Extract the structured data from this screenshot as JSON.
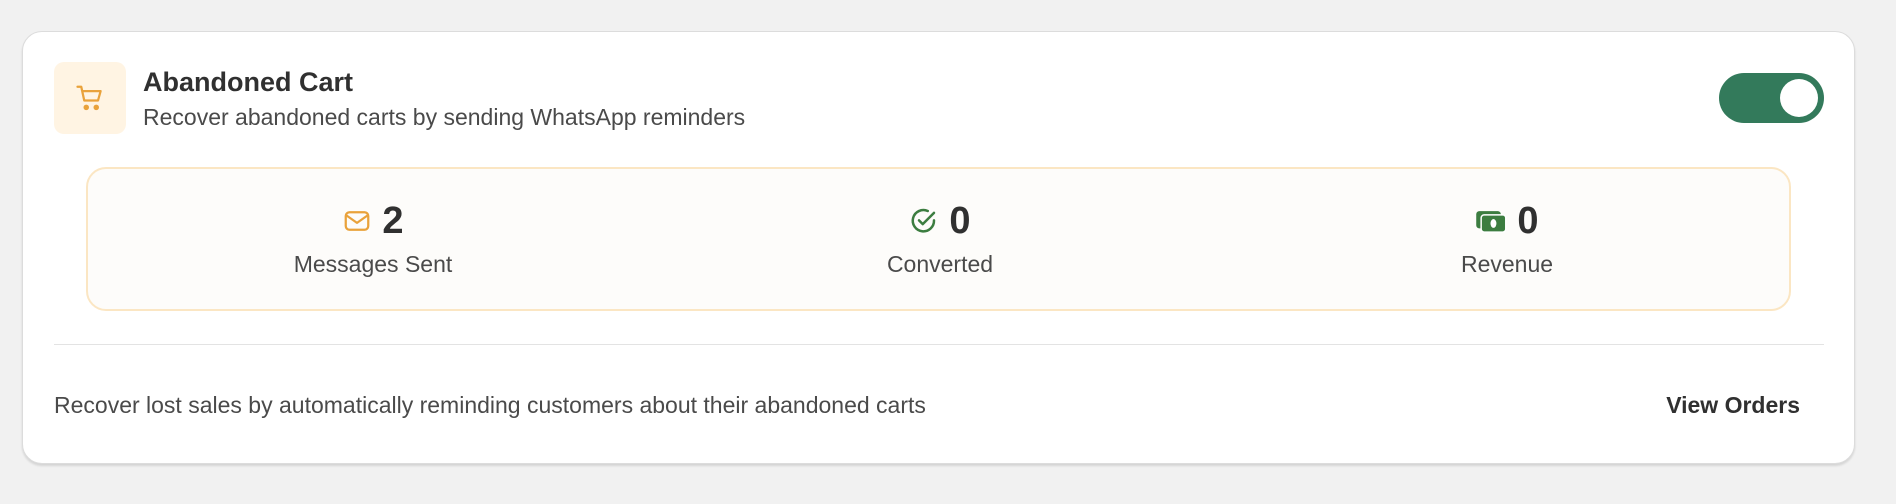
{
  "card": {
    "title": "Abandoned Cart",
    "subtitle": "Recover abandoned carts by sending WhatsApp reminders",
    "icon": "cart-icon",
    "enabled": true
  },
  "stats": [
    {
      "icon": "envelope-icon",
      "value": "2",
      "label": "Messages Sent",
      "color": "#e9a23b"
    },
    {
      "icon": "check-circle-icon",
      "value": "0",
      "label": "Converted",
      "color": "#3c7d40"
    },
    {
      "icon": "money-icon",
      "value": "0",
      "label": "Revenue",
      "color": "#3c7d40"
    }
  ],
  "footer": {
    "description": "Recover lost sales by automatically reminding customers about their abandoned carts",
    "view_orders_label": "View Orders"
  },
  "colors": {
    "accent_orange": "#e9a23b",
    "toggle_green": "#337a5b",
    "stats_border": "#fbe6c3"
  }
}
